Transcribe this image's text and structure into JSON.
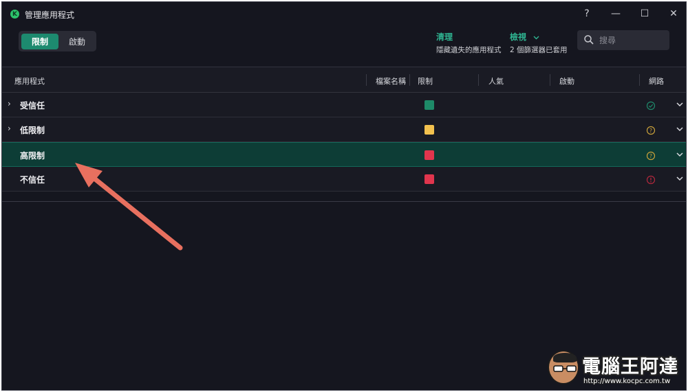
{
  "window": {
    "title": "管理應用程式",
    "logo_letter": "K",
    "help_icon": "?",
    "minimize_icon": "—",
    "maximize_icon": "☐",
    "close_icon": "✕"
  },
  "toolbar": {
    "tabs": [
      {
        "label": "限制",
        "active": true
      },
      {
        "label": "啟動",
        "active": false
      }
    ],
    "cleanup": {
      "label": "清理",
      "sub": "隱藏遺失的應用程式"
    },
    "view": {
      "label": "檢視",
      "sub": "2 個篩選器已套用",
      "icon": "chevron-down-icon"
    },
    "search": {
      "placeholder": "搜尋",
      "value": ""
    }
  },
  "table": {
    "columns": [
      "應用程式",
      "檔案名稱",
      "限制",
      "人氣",
      "啟動",
      "網路"
    ],
    "rows": [
      {
        "name": "受信任",
        "expandable": true,
        "expander": "›",
        "restriction_color": "#1e8a68",
        "network_icon": "check-circle-icon",
        "network_color": "#1f8a6b",
        "selected": false
      },
      {
        "name": "低限制",
        "expandable": true,
        "expander": "›",
        "restriction_color": "#f2c14e",
        "network_icon": "question-circle-icon",
        "network_color": "#c9a13a",
        "selected": false
      },
      {
        "name": "高限制",
        "expandable": false,
        "expander": "",
        "restriction_color": "#e0354d",
        "network_icon": "question-circle-icon",
        "network_color": "#c9a13a",
        "selected": true
      },
      {
        "name": "不信任",
        "expandable": false,
        "expander": "",
        "restriction_color": "#e0354d",
        "network_icon": "alert-circle-icon",
        "network_color": "#b3283d",
        "selected": false
      }
    ]
  },
  "annotation": {
    "color": "#e8705f"
  },
  "watermark": {
    "title": "電腦王阿達",
    "url": "http://www.kocpc.com.tw"
  }
}
